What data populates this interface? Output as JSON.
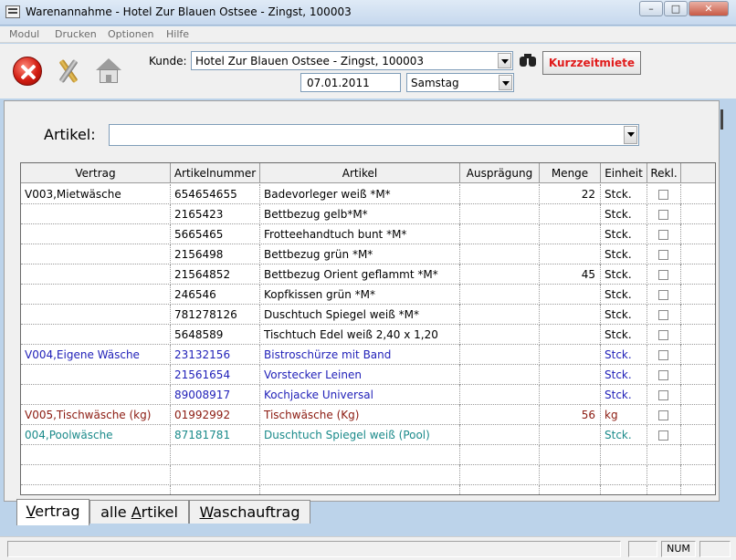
{
  "window": {
    "title": "Warenannahme - Hotel Zur Blauen Ostsee - Zingst, 100003"
  },
  "menu": [
    "Modul",
    "Drucken",
    "Optionen",
    "Hilfe"
  ],
  "toolbar": {
    "kunde_label": "Kunde:",
    "kunde_value": "Hotel Zur Blauen Ostsee - Zingst, 100003",
    "date": "07.01.2011",
    "day": "Samstag",
    "kurzzeitmiete": "Kurzzeitmiete"
  },
  "filter": {
    "artikel_label": "Artikel:",
    "artikel_value": ""
  },
  "colors": {
    "blue": "#1f1fb8",
    "red": "#8b1a10",
    "teal": "#1a8a8a",
    "black": "#000000"
  },
  "grid": {
    "headers": [
      "Vertrag",
      "Artikelnummer",
      "Artikel",
      "Ausprägung",
      "Menge",
      "Einheit",
      "Rekl."
    ],
    "rows": [
      {
        "vertrag": "V003,Mietwäsche",
        "artnr": "654654655",
        "artikel": "Badevorleger weiß *M*",
        "auspr": "",
        "menge": "22",
        "einheit": "Stck.",
        "color": "#000000"
      },
      {
        "vertrag": "",
        "artnr": "2165423",
        "artikel": "Bettbezug gelb*M*",
        "auspr": "",
        "menge": "",
        "einheit": "Stck.",
        "color": "#000000"
      },
      {
        "vertrag": "",
        "artnr": "5665465",
        "artikel": "Frotteehandtuch bunt  *M*",
        "auspr": "",
        "menge": "",
        "einheit": "Stck.",
        "color": "#000000"
      },
      {
        "vertrag": "",
        "artnr": "2156498",
        "artikel": "Bettbezug grün *M*",
        "auspr": "",
        "menge": "",
        "einheit": "Stck.",
        "color": "#000000"
      },
      {
        "vertrag": "",
        "artnr": "21564852",
        "artikel": "Bettbezug Orient geflammt *M*",
        "auspr": "",
        "menge": "45",
        "einheit": "Stck.",
        "color": "#000000"
      },
      {
        "vertrag": "",
        "artnr": "246546",
        "artikel": "Kopfkissen grün *M*",
        "auspr": "",
        "menge": "",
        "einheit": "Stck.",
        "color": "#000000"
      },
      {
        "vertrag": "",
        "artnr": "781278126",
        "artikel": "Duschtuch Spiegel weiß *M*",
        "auspr": "",
        "menge": "",
        "einheit": "Stck.",
        "color": "#000000"
      },
      {
        "vertrag": "",
        "artnr": "5648589",
        "artikel": "Tischtuch Edel weiß 2,40 x 1,20",
        "auspr": "",
        "menge": "",
        "einheit": "Stck.",
        "color": "#000000"
      },
      {
        "vertrag": "V004,Eigene Wäsche",
        "artnr": "23132156",
        "artikel": "Bistroschürze mit Band",
        "auspr": "",
        "menge": "",
        "einheit": "Stck.",
        "color": "#1f1fb8"
      },
      {
        "vertrag": "",
        "artnr": "21561654",
        "artikel": "Vorstecker Leinen",
        "auspr": "",
        "menge": "",
        "einheit": "Stck.",
        "color": "#1f1fb8"
      },
      {
        "vertrag": "",
        "artnr": "89008917",
        "artikel": "Kochjacke Universal",
        "auspr": "",
        "menge": "",
        "einheit": "Stck.",
        "color": "#1f1fb8"
      },
      {
        "vertrag": "V005,Tischwäsche (kg)",
        "artnr": "01992992",
        "artikel": "Tischwäsche (Kg)",
        "auspr": "",
        "menge": "56",
        "einheit": "kg",
        "color": "#8b1a10"
      },
      {
        "vertrag": "004,Poolwäsche",
        "artnr": "87181781",
        "artikel": "Duschtuch Spiegel weiß (Pool)",
        "auspr": "",
        "menge": "",
        "einheit": "Stck.",
        "color": "#1a8a8a"
      }
    ],
    "empty_rows": 3
  },
  "tabs": [
    {
      "pre": "",
      "u": "V",
      "post": "ertrag",
      "active": true
    },
    {
      "pre": "alle ",
      "u": "A",
      "post": "rtikel",
      "active": false
    },
    {
      "pre": "",
      "u": "W",
      "post": "aschauftrag",
      "active": false
    }
  ],
  "statusbar": {
    "num": "NUM"
  }
}
